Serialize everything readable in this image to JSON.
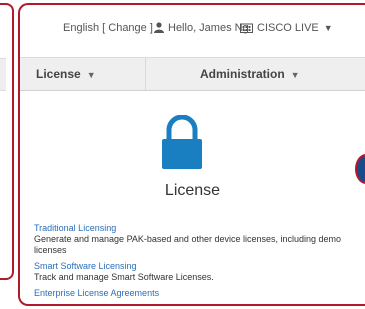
{
  "topbar": {
    "language": "English",
    "change_label": "[ Change ]",
    "greeting": "Hello, James Ng",
    "org": "CISCO LIVE"
  },
  "nav": {
    "license_label": "License",
    "admin_label": "Administration"
  },
  "tile": {
    "title": "License",
    "icon": "lock-icon",
    "icon_color": "#1a7fc1"
  },
  "links": [
    {
      "label": "Traditional Licensing",
      "desc": "Generate and manage PAK-based and other device licenses, including demo licenses"
    },
    {
      "label": "Smart Software Licensing",
      "desc": "Track and manage Smart Software Licenses."
    },
    {
      "label": "Enterprise License Agreements",
      "desc": ""
    }
  ],
  "colors": {
    "callout_border": "#b01a2a",
    "link": "#2a6ebb",
    "nav_bg": "#efefef"
  }
}
